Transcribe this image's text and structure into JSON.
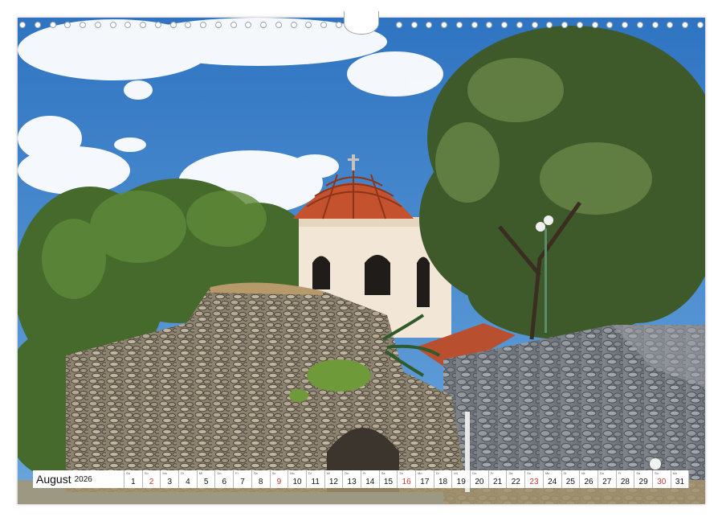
{
  "calendar": {
    "month": "August",
    "year": "2026",
    "days": [
      {
        "n": "1",
        "wd": "Sa",
        "sun": false
      },
      {
        "n": "2",
        "wd": "So",
        "sun": true
      },
      {
        "n": "3",
        "wd": "Mo",
        "sun": false
      },
      {
        "n": "4",
        "wd": "Di",
        "sun": false
      },
      {
        "n": "5",
        "wd": "Mi",
        "sun": false
      },
      {
        "n": "6",
        "wd": "Do",
        "sun": false
      },
      {
        "n": "7",
        "wd": "Fr",
        "sun": false
      },
      {
        "n": "8",
        "wd": "Sa",
        "sun": false
      },
      {
        "n": "9",
        "wd": "So",
        "sun": true
      },
      {
        "n": "10",
        "wd": "Mo",
        "sun": false
      },
      {
        "n": "11",
        "wd": "Di",
        "sun": false
      },
      {
        "n": "12",
        "wd": "Mi",
        "sun": false
      },
      {
        "n": "13",
        "wd": "Do",
        "sun": false
      },
      {
        "n": "14",
        "wd": "Fr",
        "sun": false
      },
      {
        "n": "15",
        "wd": "Sa",
        "sun": false
      },
      {
        "n": "16",
        "wd": "So",
        "sun": true
      },
      {
        "n": "17",
        "wd": "Mo",
        "sun": false
      },
      {
        "n": "18",
        "wd": "Di",
        "sun": false
      },
      {
        "n": "19",
        "wd": "Mi",
        "sun": false
      },
      {
        "n": "20",
        "wd": "Do",
        "sun": false
      },
      {
        "n": "21",
        "wd": "Fr",
        "sun": false
      },
      {
        "n": "22",
        "wd": "Sa",
        "sun": false
      },
      {
        "n": "23",
        "wd": "So",
        "sun": true
      },
      {
        "n": "24",
        "wd": "Mo",
        "sun": false
      },
      {
        "n": "25",
        "wd": "Di",
        "sun": false
      },
      {
        "n": "26",
        "wd": "Mi",
        "sun": false
      },
      {
        "n": "27",
        "wd": "Do",
        "sun": false
      },
      {
        "n": "28",
        "wd": "Fr",
        "sun": false
      },
      {
        "n": "29",
        "wd": "Sa",
        "sun": false
      },
      {
        "n": "30",
        "wd": "So",
        "sun": true
      },
      {
        "n": "31",
        "wd": "Mo",
        "sun": false
      }
    ]
  },
  "colors": {
    "sky": "#3d7fc6",
    "roof": "#c4522e",
    "tree_dark": "#3f5a2a",
    "stone": "#8a8478",
    "sunday_red": "#c0392b"
  }
}
